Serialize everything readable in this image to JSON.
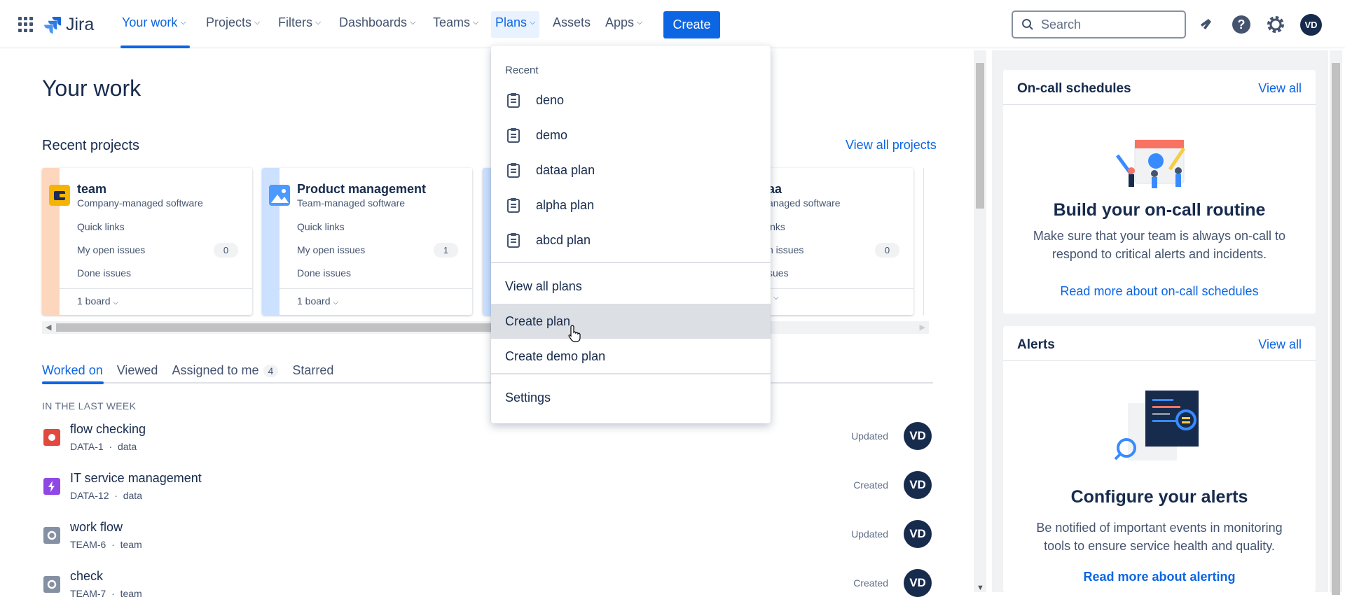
{
  "nav": {
    "logo": "Jira",
    "items": [
      {
        "label": "Your work",
        "chevron": true
      },
      {
        "label": "Projects",
        "chevron": true
      },
      {
        "label": "Filters",
        "chevron": true
      },
      {
        "label": "Dashboards",
        "chevron": true
      },
      {
        "label": "Teams",
        "chevron": true
      },
      {
        "label": "Plans",
        "chevron": true
      },
      {
        "label": "Assets",
        "chevron": false
      },
      {
        "label": "Apps",
        "chevron": true
      }
    ],
    "create_label": "Create",
    "search_placeholder": "Search",
    "avatar_initials": "VD"
  },
  "main": {
    "title": "Your work",
    "recent_projects_title": "Recent projects",
    "view_all_projects": "View all projects",
    "projects": [
      {
        "name": "team",
        "type": "Company-managed software",
        "quick_links": "Quick links",
        "open_issues_label": "My open issues",
        "open_issues_count": "0",
        "done_label": "Done issues",
        "board_label": "1 board"
      },
      {
        "name": "Product management",
        "type": "Team-managed software",
        "quick_links": "Quick links",
        "open_issues_label": "My open issues",
        "open_issues_count": "1",
        "done_label": "Done issues",
        "board_label": "1 board"
      },
      {
        "name": "aa",
        "type": "anaged software",
        "quick_links": "inks",
        "open_issues_label": "n issues",
        "open_issues_count": "0",
        "done_label": "sues",
        "board_label": ""
      }
    ],
    "tabs": [
      {
        "label": "Worked on"
      },
      {
        "label": "Viewed"
      },
      {
        "label": "Assigned to me",
        "badge": "4"
      },
      {
        "label": "Starred"
      }
    ],
    "section_label": "IN THE LAST WEEK",
    "items": [
      {
        "title": "flow checking",
        "key": "DATA-1",
        "project": "data",
        "status": "Updated",
        "avatar": "VD",
        "icon_color": "#e2483d"
      },
      {
        "title": "IT service management",
        "key": "DATA-12",
        "project": "data",
        "status": "Created",
        "avatar": "VD",
        "icon_color": "#8f47e5"
      },
      {
        "title": "work flow",
        "key": "TEAM-6",
        "project": "team",
        "status": "Updated",
        "avatar": "VD",
        "icon_color": "#8590a2"
      },
      {
        "title": "check",
        "key": "TEAM-7",
        "project": "team",
        "status": "Created",
        "avatar": "VD",
        "icon_color": "#8590a2"
      }
    ]
  },
  "sidebar": {
    "oncall": {
      "title": "On-call schedules",
      "view_all": "View all",
      "heading": "Build your on-call routine",
      "desc": "Make sure that your team is always on-call to respond to critical alerts and incidents.",
      "link": "Read more about on-call schedules"
    },
    "alerts": {
      "title": "Alerts",
      "view_all": "View all",
      "heading": "Configure your alerts",
      "desc": "Be notified of important events in monitoring tools to ensure service health and quality.",
      "link": "Read more about alerting"
    }
  },
  "plans_menu": {
    "recent_label": "Recent",
    "recent": [
      "deno",
      "demo",
      "dataa plan",
      "alpha plan",
      "abcd plan"
    ],
    "view_all": "View all plans",
    "create": "Create plan",
    "create_demo": "Create demo plan",
    "settings": "Settings"
  },
  "colors": {
    "accent": "#0c66e4",
    "dark": "#172b4d",
    "hover": "#dcdfe4"
  }
}
